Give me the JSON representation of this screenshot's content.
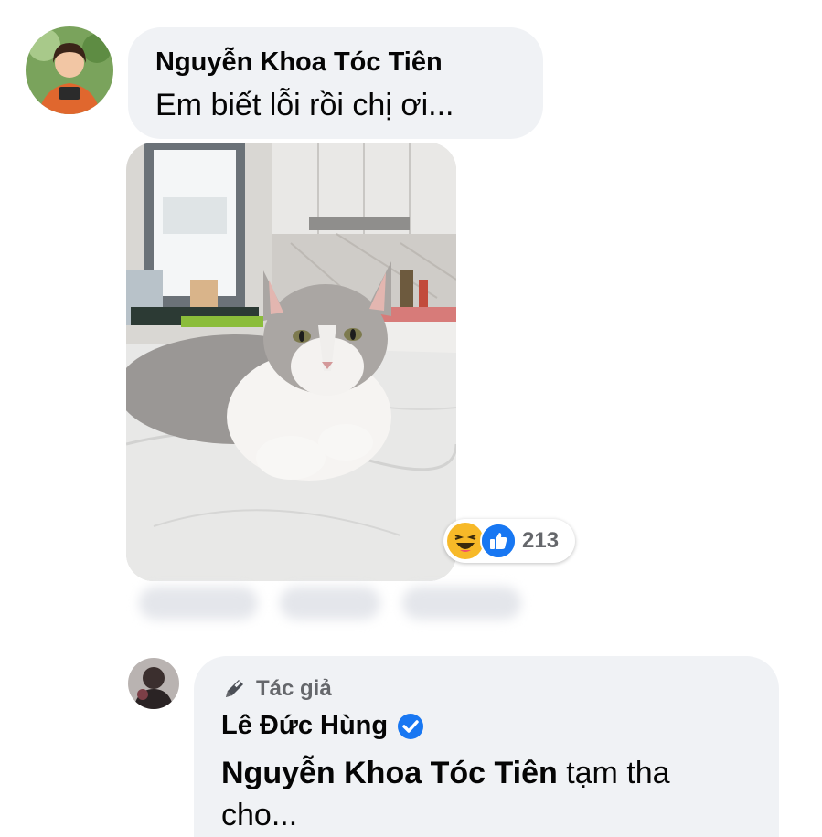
{
  "comment1": {
    "author": "Nguyễn Khoa Tóc Tiên",
    "text": "Em biết lỗi rồi chị ơi...",
    "reactions": {
      "icons": [
        "haha-icon",
        "like-icon"
      ],
      "count": "213"
    }
  },
  "reply": {
    "badge_label": "Tác giả",
    "author": "Lê Đức Hùng",
    "mention": "Nguyễn Khoa Tóc Tiên",
    "text": " tạm tha cho..."
  },
  "colors": {
    "bubble": "#f0f2f5",
    "verified": "#1877f2",
    "like": "#1877f2",
    "haha": "#f7b928"
  }
}
